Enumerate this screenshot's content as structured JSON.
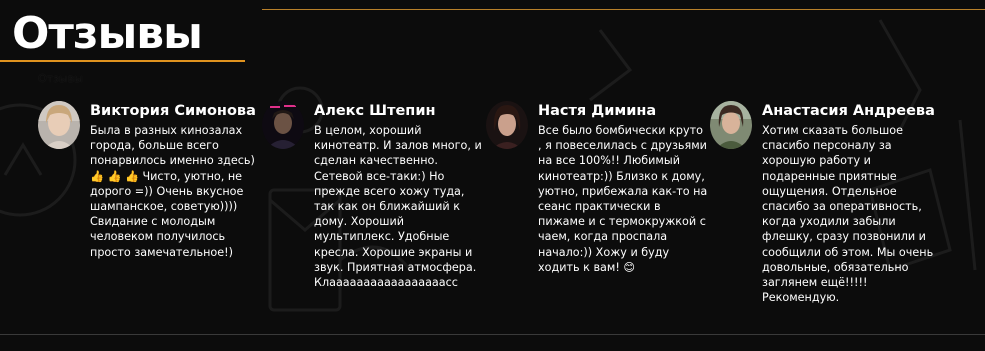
{
  "section": {
    "title": "Отзывы",
    "subtitle": "Отзывы"
  },
  "reviews": [
    {
      "name": "Виктория Симонова",
      "text": "Была в разных кинозалах города, больше всего понарвилось именно здесь) 👍 👍 👍 Чисто, уютно, не дорого =)) Очень вкусное шампанское, советую)))) Свидание с молодым человеком получилось просто замечательное!)"
    },
    {
      "name": "Алекс Штепин",
      "text": "В целом, хороший кинотеатр. И залов много, и сделан качественно. Сетевой все-таки:) Но прежде всего хожу туда, так как он ближайший к дому. Хороший мультиплекс. Удобные кресла. Хорошие экраны и звук. Приятная атмосфера. Клааааааааааааааааасс"
    },
    {
      "name": "Настя Димина",
      "text": "Все было бомбически круто , я повеселилась с друзьями на все 100%!! Любимый кинотеатр:)) Близко к дому, уютно, прибежала как-то на сеанс практически в пижаме и с термокружкой с чаем, когда проспала начало:)) Хожу и буду ходить к вам! 😊"
    },
    {
      "name": "Анастасия Андреева",
      "text": "Хотим сказать большое спасибо персоналу за хорошую работу и подаренные приятные ощущения. Отдельное спасибо за оперативность, когда уходили забыли флешку, сразу позвонили и сообщили об этом. Мы очень довольные, обязательно заглянем ещё!!!!! Рекомендую."
    }
  ],
  "colors": {
    "background": "#0c0c0c",
    "accent": "#e0931f",
    "text": "#ffffff"
  }
}
